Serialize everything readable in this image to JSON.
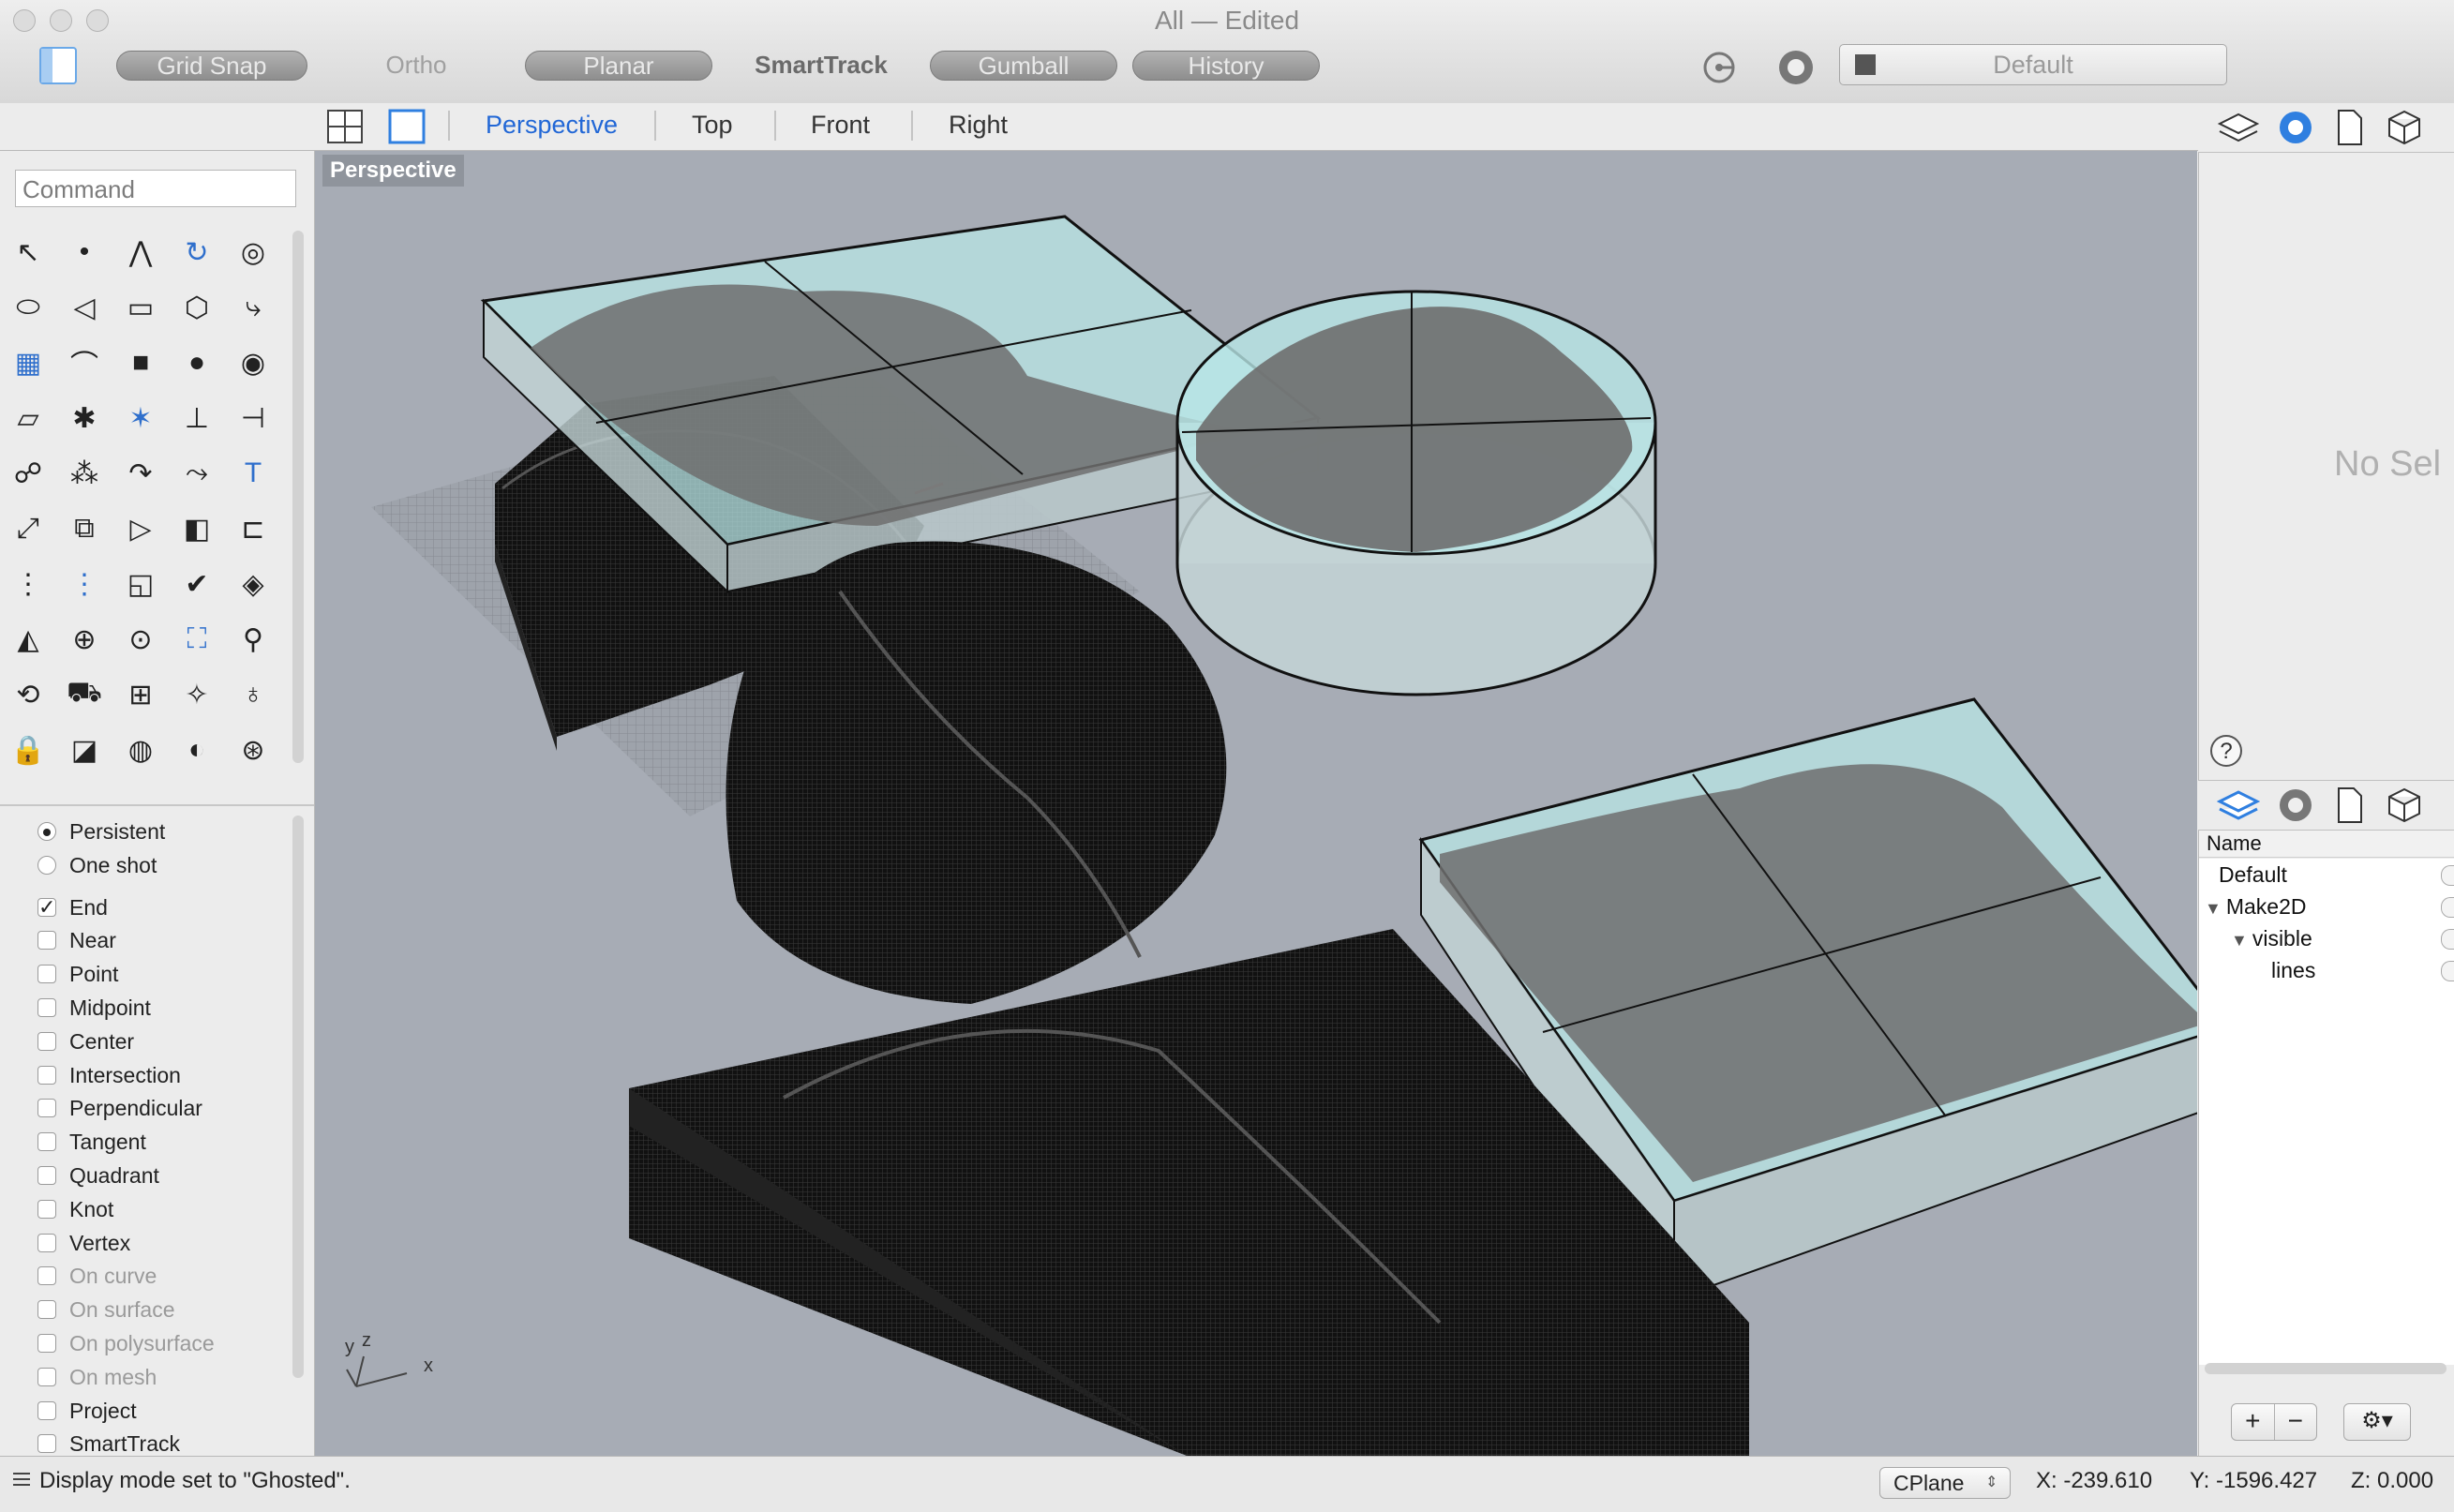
{
  "window": {
    "title": "All — Edited"
  },
  "toolbar": {
    "grid_snap": "Grid Snap",
    "ortho": "Ortho",
    "planar": "Planar",
    "smarttrack": "SmartTrack",
    "gumball": "Gumball",
    "history": "History",
    "layer_value": "Default"
  },
  "viewport_tabs": [
    "Perspective",
    "Top",
    "Front",
    "Right"
  ],
  "viewport": {
    "label": "Perspective",
    "axis_x": "x",
    "axis_y": "y",
    "axis_z": "z"
  },
  "command": {
    "placeholder": "Command"
  },
  "osnap": {
    "modes": [
      {
        "label": "Persistent",
        "type": "radio",
        "checked": true,
        "enabled": true
      },
      {
        "label": "One shot",
        "type": "radio",
        "checked": false,
        "enabled": true
      },
      {
        "label": "End",
        "type": "check",
        "checked": true,
        "enabled": true
      },
      {
        "label": "Near",
        "type": "check",
        "checked": false,
        "enabled": true
      },
      {
        "label": "Point",
        "type": "check",
        "checked": false,
        "enabled": true
      },
      {
        "label": "Midpoint",
        "type": "check",
        "checked": false,
        "enabled": true
      },
      {
        "label": "Center",
        "type": "check",
        "checked": false,
        "enabled": true
      },
      {
        "label": "Intersection",
        "type": "check",
        "checked": false,
        "enabled": true
      },
      {
        "label": "Perpendicular",
        "type": "check",
        "checked": false,
        "enabled": true
      },
      {
        "label": "Tangent",
        "type": "check",
        "checked": false,
        "enabled": true
      },
      {
        "label": "Quadrant",
        "type": "check",
        "checked": false,
        "enabled": true
      },
      {
        "label": "Knot",
        "type": "check",
        "checked": false,
        "enabled": true
      },
      {
        "label": "Vertex",
        "type": "check",
        "checked": false,
        "enabled": true
      },
      {
        "label": "On curve",
        "type": "check",
        "checked": false,
        "enabled": false
      },
      {
        "label": "On surface",
        "type": "check",
        "checked": false,
        "enabled": false
      },
      {
        "label": "On polysurface",
        "type": "check",
        "checked": false,
        "enabled": false
      },
      {
        "label": "On mesh",
        "type": "check",
        "checked": false,
        "enabled": false
      },
      {
        "label": "Project",
        "type": "check",
        "checked": false,
        "enabled": true
      },
      {
        "label": "SmartTrack",
        "type": "check",
        "checked": false,
        "enabled": true
      }
    ]
  },
  "properties": {
    "empty_text": "No Sel"
  },
  "layers": {
    "column_name": "Name",
    "items": [
      {
        "name": "Default",
        "depth": 0,
        "expanded": null
      },
      {
        "name": "Make2D",
        "depth": 0,
        "expanded": true
      },
      {
        "name": "visible",
        "depth": 1,
        "expanded": true
      },
      {
        "name": "lines",
        "depth": 2,
        "expanded": null
      }
    ],
    "add": "+",
    "remove": "−"
  },
  "status": {
    "message": "Display mode set to \"Ghosted\".",
    "cplane": "CPlane",
    "x": "X: -239.610",
    "y": "Y: -1596.427",
    "z": "Z: 0.000"
  },
  "colors": {
    "accent": "#2167d6",
    "viewport_bg": "#a7acb5",
    "glass": "#a8dede"
  },
  "tool_icons": [
    "select-arrow-icon",
    "point-icon",
    "polyline-icon",
    "curve-icon",
    "circle-icon",
    "ellipse-icon",
    "arc-icon",
    "rectangle-icon",
    "polygon-icon",
    "fillet-icon",
    "surface-icon",
    "sweep-icon",
    "box-icon",
    "sphere-icon",
    "cylinder-icon",
    "plane-icon",
    "gear-puzzle-icon",
    "explode-icon",
    "trim-icon",
    "split-icon",
    "boolean-icon",
    "group-icon",
    "rotate-icon",
    "blend-icon",
    "text-icon",
    "move-icon",
    "transform-icon",
    "orient-icon",
    "solid-edit-icon",
    "dim-icon",
    "array-icon",
    "layer-icon",
    "surface-edit-icon",
    "check-icon",
    "analyze-icon",
    "render-icon",
    "zoom-icon",
    "zoom-window-icon",
    "zoom-extents-icon",
    "pan-icon",
    "rotate-view-icon",
    "car-icon",
    "mesh-icon",
    "properties-icon",
    "light-icon",
    "lock-icon",
    "layers-book-icon",
    "color-wheel-icon",
    "sphere-shade-icon",
    "globe-grid-icon"
  ]
}
